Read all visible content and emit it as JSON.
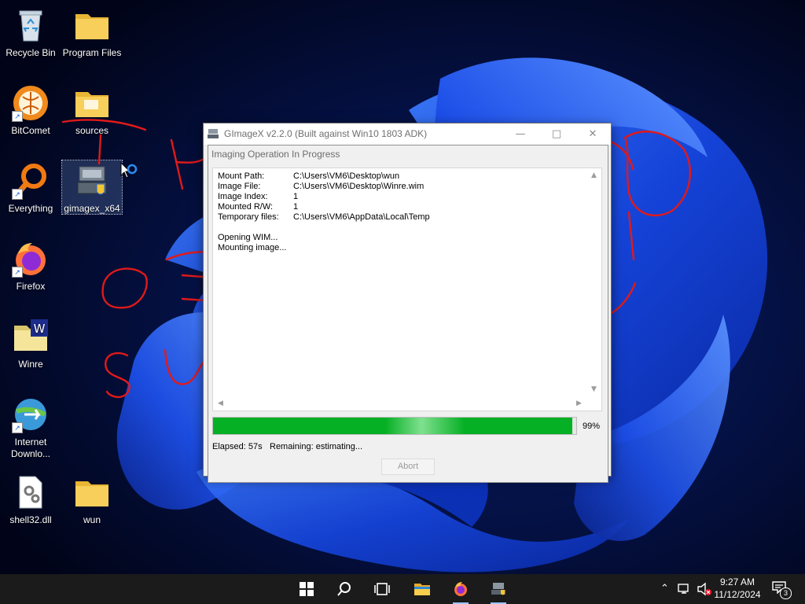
{
  "desktop": {
    "icons": [
      {
        "label": "Recycle Bin"
      },
      {
        "label": "Program Files"
      },
      {
        "label": "BitComet"
      },
      {
        "label": "sources"
      },
      {
        "label": "Everything"
      },
      {
        "label": "gimagex_x64"
      },
      {
        "label": "Firefox"
      },
      {
        "label": "Winre"
      },
      {
        "label": "Internet Downlo..."
      },
      {
        "label": "shell32.dll"
      },
      {
        "label": "wun"
      }
    ]
  },
  "window": {
    "title": "GImageX v2.2.0 (Built against Win10 1803 ADK)"
  },
  "dialog": {
    "title": "Imaging Operation In Progress",
    "details": [
      {
        "key": "Mount Path:",
        "value": "C:\\Users\\VM6\\Desktop\\wun"
      },
      {
        "key": "Image File:",
        "value": "C:\\Users\\VM6\\Desktop\\Winre.wim"
      },
      {
        "key": "Image Index:",
        "value": "1"
      },
      {
        "key": "Mounted R/W:",
        "value": "1"
      },
      {
        "key": "Temporary files:",
        "value": "C:\\Users\\VM6\\AppData\\Local\\Temp"
      }
    ],
    "log": [
      "Opening WIM...",
      "Mounting image..."
    ],
    "progress": {
      "value": 99,
      "label": "99%"
    },
    "elapsed": "Elapsed: 57s",
    "remaining": "Remaining: estimating...",
    "abort_label": "Abort"
  },
  "taskbar": {
    "items": [
      "start-icon",
      "search-icon",
      "task-view-icon",
      "file-explorer-icon",
      "firefox-icon",
      "gimagex-icon"
    ],
    "clock": {
      "time": "9:27 AM",
      "date": "11/12/2024"
    },
    "notification_count": "3"
  },
  "colors": {
    "progress_green": "#06b025",
    "taskbar": "#1b1b1b",
    "annotation_red": "#e01a1a"
  }
}
